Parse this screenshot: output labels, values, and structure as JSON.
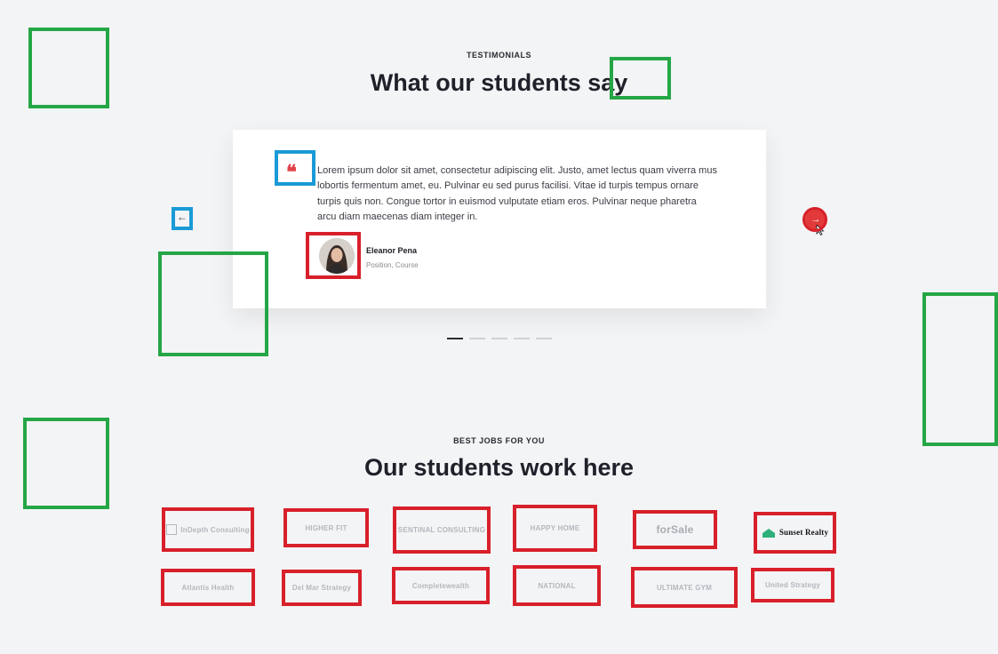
{
  "testimonials": {
    "eyebrow": "TESTIMONIALS",
    "heading": "What our students say",
    "quote_mark": "❝",
    "quote": "Lorem ipsum dolor sit amet, consectetur adipiscing elit. Justo, amet lectus quam viverra mus lobortis fermentum amet, eu. Pulvinar eu sed purus facilisi. Vitae id turpis tempus ornare turpis quis non. Congue tortor in euismod vulputate etiam eros. Pulvinar neque pharetra arcu diam maecenas diam integer in.",
    "author_name": "Eleanor Pena",
    "author_role": "Position, Course",
    "prev_label": "←",
    "next_label": "→",
    "slides_total": 5,
    "active_slide": 1
  },
  "jobs": {
    "eyebrow": "BEST JOBS FOR YOU",
    "heading": "Our students work here",
    "logos_row1": [
      "InDepth Consulting",
      "HIGHER FIT",
      "SENTINAL CONSULTING",
      "HAPPY HOME",
      "forSale",
      "Sunset Realty"
    ],
    "logos_row2": [
      "Atlantis Health",
      "Del Mar Strategy",
      "Completewealth",
      "NATIONAL",
      "ULTIMATE GYM",
      "United Strategy"
    ]
  },
  "colors": {
    "accent": "#e23a3a",
    "annotation_green": "#25a646",
    "annotation_red": "#d8202a",
    "annotation_blue": "#1a9ad6"
  }
}
